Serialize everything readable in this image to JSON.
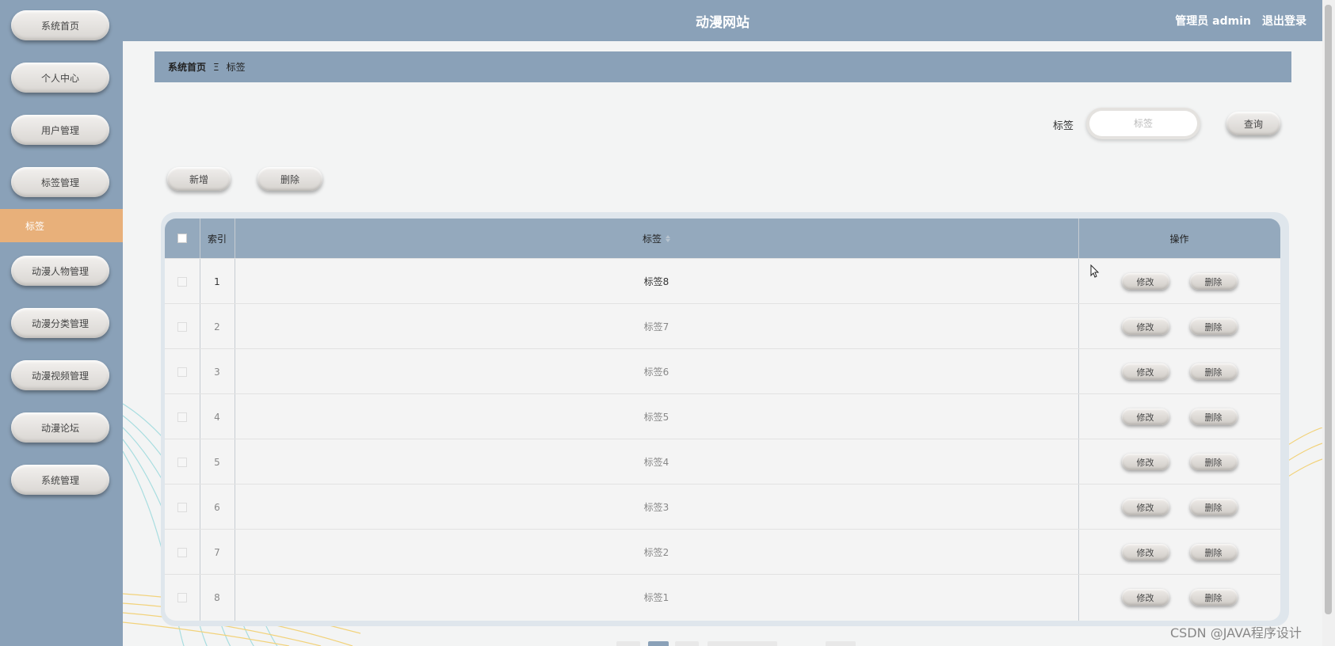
{
  "app": {
    "title": "动漫网站"
  },
  "topbar": {
    "user_label": "管理员 admin",
    "logout": "退出登录"
  },
  "sidebar": {
    "items": [
      {
        "label": "系统首页"
      },
      {
        "label": "个人中心"
      },
      {
        "label": "用户管理"
      },
      {
        "label": "标签管理"
      },
      {
        "label": "动漫人物管理"
      },
      {
        "label": "动漫分类管理"
      },
      {
        "label": "动漫视频管理"
      },
      {
        "label": "动漫论坛"
      },
      {
        "label": "系统管理"
      }
    ],
    "active_sub": "标签"
  },
  "breadcrumb": {
    "home": "系统首页",
    "separator": "Ξ",
    "current": "标签"
  },
  "search": {
    "label": "标签",
    "placeholder": "标签",
    "button": "查询"
  },
  "actions": {
    "add": "新增",
    "delete": "删除"
  },
  "table": {
    "headers": {
      "index": "索引",
      "tag": "标签",
      "ops": "操作"
    },
    "edit_label": "修改",
    "delete_label": "删除",
    "rows": [
      {
        "index": "1",
        "tag": "标签8"
      },
      {
        "index": "2",
        "tag": "标签7"
      },
      {
        "index": "3",
        "tag": "标签6"
      },
      {
        "index": "4",
        "tag": "标签5"
      },
      {
        "index": "5",
        "tag": "标签4"
      },
      {
        "index": "6",
        "tag": "标签3"
      },
      {
        "index": "7",
        "tag": "标签2"
      },
      {
        "index": "8",
        "tag": "标签1"
      }
    ]
  },
  "watermark": "CSDN @JAVA程序设计",
  "colors": {
    "nav": "#8aa1b8",
    "active": "#e8b07a",
    "table_header": "#94a9bd"
  }
}
